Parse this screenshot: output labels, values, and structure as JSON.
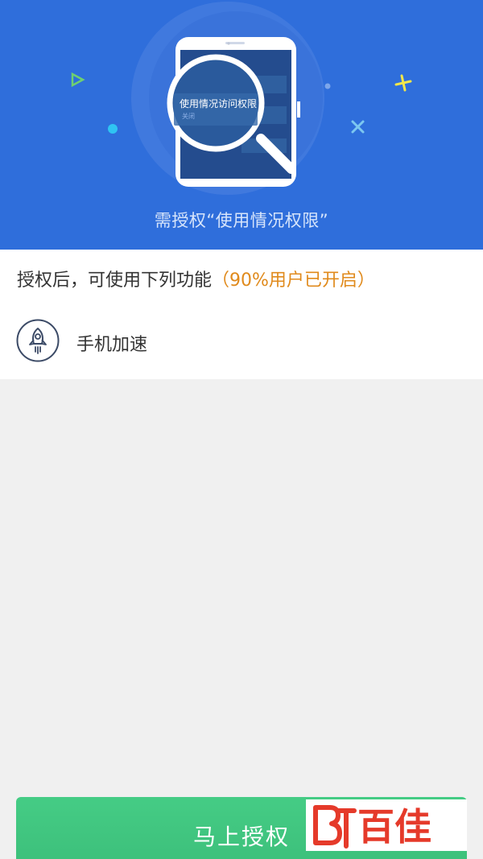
{
  "hero": {
    "magnifier_title": "使用情况访问权限",
    "magnifier_sub": "关闭",
    "caption": "需授权“使用情况权限”"
  },
  "card": {
    "heading": "授权后，可使用下列功能",
    "highlight": "（90%用户已开启）",
    "feature_label": "手机加速",
    "feature_icon": "rocket-icon"
  },
  "button": {
    "label": "马上授权"
  },
  "watermark": {
    "text": "百佳"
  },
  "colors": {
    "hero_bg": "#2f6edb",
    "accent_orange": "#e08a1c",
    "button_green": "#3cbf7a"
  }
}
